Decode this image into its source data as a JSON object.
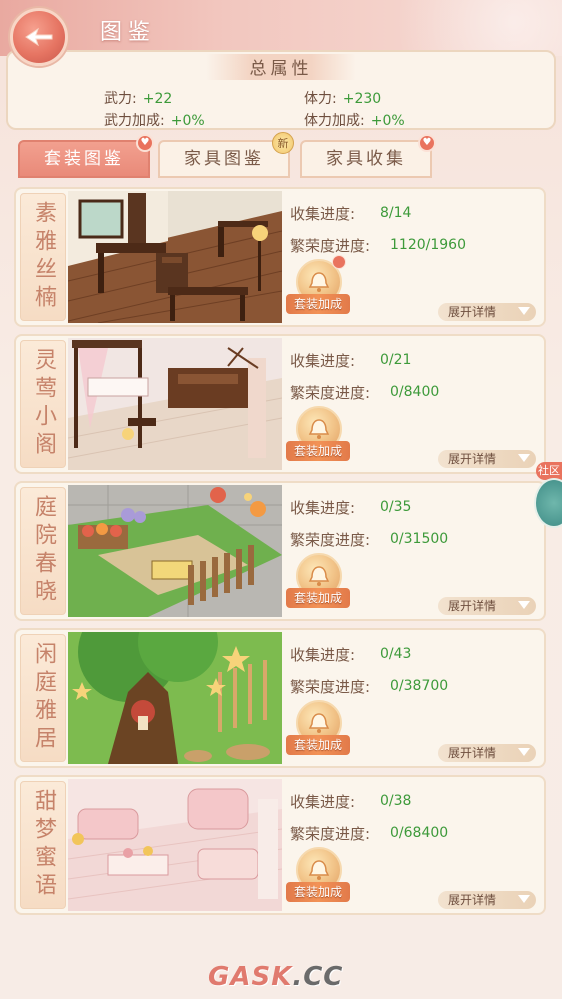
{
  "header": {
    "title": "图鉴"
  },
  "attributes": {
    "title": "总属性",
    "items": [
      {
        "label": "武力:",
        "value": "+22"
      },
      {
        "label": "体力:",
        "value": "+230"
      },
      {
        "label": "武力加成:",
        "value": "+0%"
      },
      {
        "label": "体力加成:",
        "value": "+0%"
      }
    ]
  },
  "tabs": [
    {
      "label": "套装图鉴",
      "active": true
    },
    {
      "label": "家具图鉴",
      "badge": "新"
    },
    {
      "label": "家具收集"
    }
  ],
  "cards": [
    {
      "name": "素雅丝楠",
      "collect_label": "收集进度:",
      "collect_value": "8/14",
      "prosper_label": "繁荣度进度:",
      "prosper_value": "1120/1960",
      "bonus_label": "套装加成",
      "expand_label": "展开详情",
      "scene": "study"
    },
    {
      "name": "灵莺小阁",
      "collect_label": "收集进度:",
      "collect_value": "0/21",
      "prosper_label": "繁荣度进度:",
      "prosper_value": "0/8400",
      "bonus_label": "套装加成",
      "expand_label": "展开详情",
      "scene": "bedroom"
    },
    {
      "name": "庭院春晓",
      "collect_label": "收集进度:",
      "collect_value": "0/35",
      "prosper_label": "繁荣度进度:",
      "prosper_value": "0/31500",
      "bonus_label": "套装加成",
      "expand_label": "展开详情",
      "scene": "garden"
    },
    {
      "name": "闲庭雅居",
      "collect_label": "收集进度:",
      "collect_value": "0/43",
      "prosper_label": "繁荣度进度:",
      "prosper_value": "0/38700",
      "bonus_label": "套装加成",
      "expand_label": "展开详情",
      "scene": "treehouse"
    },
    {
      "name": "甜梦蜜语",
      "collect_label": "收集进度:",
      "collect_value": "0/38",
      "prosper_label": "繁荣度进度:",
      "prosper_value": "0/68400",
      "bonus_label": "套装加成",
      "expand_label": "展开详情",
      "scene": "pinkroom"
    }
  ],
  "community": {
    "label": "社区"
  },
  "watermark": {
    "brand": "GASK",
    "suffix": ".CC"
  },
  "colors": {
    "accent": "#e98a79",
    "value_green": "#3d9a3a",
    "text_brown": "#7a5a48"
  }
}
